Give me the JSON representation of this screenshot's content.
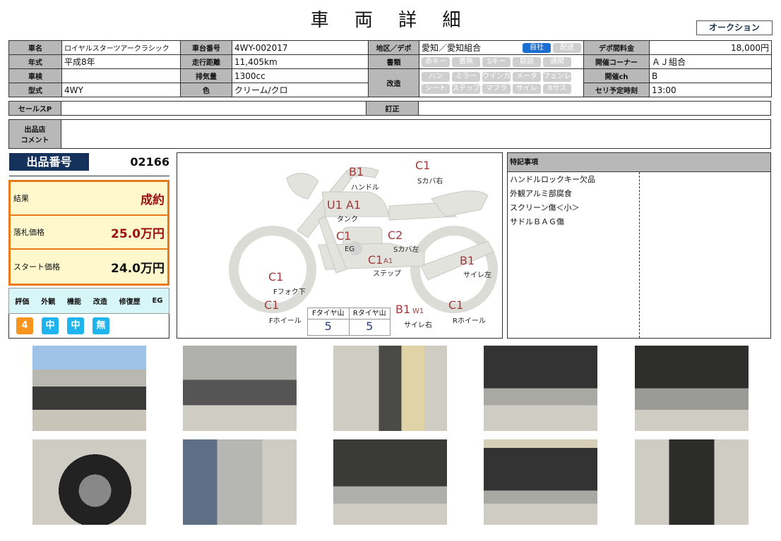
{
  "title": "車 両 詳 細",
  "auction_badge": "オークション",
  "info": {
    "rows": [
      {
        "l1": "車名",
        "v1": "ロイヤルスターツアークラシック",
        "l2": "車台番号",
        "v2": "4WY-002017",
        "l3": "地区／デポ",
        "v3": "愛知／愛知組合",
        "l4": "デポ間料金",
        "v4": "18,000円"
      },
      {
        "l1": "年式",
        "v1": "平成8年",
        "l2": "走行距離",
        "v2": "11,405km",
        "l3": "書類",
        "l4": "開催コーナー",
        "v4": "ＡＪ組合"
      },
      {
        "l1": "車検",
        "v1": "",
        "l2": "排気量",
        "v2": "1300cc",
        "l3": "改造",
        "l4": "開催ch",
        "v4": "B"
      },
      {
        "l1": "型式",
        "v1": "4WY",
        "l2": "色",
        "v2": "クリーム/クロ",
        "l4": "セリ予定時刻",
        "v4": "13:00"
      }
    ],
    "depot_chips": [
      {
        "label": "自社",
        "active": true
      },
      {
        "label": "配送",
        "active": false
      }
    ],
    "doc_chips": [
      "赤キー",
      "書無",
      "Sキー",
      "取説",
      "通関"
    ],
    "mod_chips_1": [
      "ハン",
      "ミラー",
      "ウインカ",
      "メータ",
      "フェンレス"
    ],
    "mod_chips_2": [
      "シート",
      "ステップ",
      "マフラ",
      "サイレ",
      "Rサス"
    ]
  },
  "sales_point": {
    "label": "セールスP",
    "value": ""
  },
  "correction": {
    "label": "訂正",
    "value": ""
  },
  "comment": {
    "label_1": "出品店",
    "label_2": "コメント",
    "value": ""
  },
  "lot": {
    "label": "出品番号",
    "number": "02166"
  },
  "result": {
    "result_label": "結果",
    "result_value": "成約",
    "bid_label": "落札価格",
    "bid_value": "25.0万円",
    "start_label": "スタート価格",
    "start_value": "24.0万円"
  },
  "evaluation": {
    "headers": [
      "評価",
      "外観",
      "機能",
      "改造",
      "修復歴",
      "EG"
    ],
    "values": [
      {
        "text": "4",
        "color": "#f7941d"
      },
      {
        "text": "中",
        "color": "#1fb4ee"
      },
      {
        "text": "中",
        "color": "#1fb4ee"
      },
      {
        "text": "無",
        "color": "#1fb4ee"
      }
    ]
  },
  "diagram": {
    "parts": [
      {
        "grade": "B1",
        "label": "ハンドル"
      },
      {
        "grade": "C1",
        "label": "Sカバ右"
      },
      {
        "grade": "U1 A1",
        "label": "タンク"
      },
      {
        "grade": "C1",
        "label": "EG"
      },
      {
        "grade": "C2",
        "label": "Sカバ左"
      },
      {
        "grade": "C1",
        "sub": "A1",
        "label": "ステップ"
      },
      {
        "grade": "B1",
        "label": "サイレ左"
      },
      {
        "grade": "C1",
        "label": "Fフォク下"
      },
      {
        "grade": "C1",
        "label": "Fホイール"
      },
      {
        "grade": "B1",
        "sub": "W1",
        "label": "サイレ右"
      },
      {
        "grade": "C1",
        "label": "Rホイール"
      }
    ],
    "tires": {
      "front_label": "Fタイヤ山",
      "front_value": "5",
      "rear_label": "Rタイヤ山",
      "rear_value": "5"
    }
  },
  "notes": {
    "header": "特記事項",
    "items": [
      "ハンドルロックキー欠品",
      "外観アルミ部腐食",
      "スクリーン傷＜小＞",
      "サドルＢＡＧ傷"
    ]
  },
  "photos": [
    "left-side",
    "right-side",
    "handlebar-tank",
    "muffler-rear",
    "engine",
    "front-wheel",
    "front-view",
    "engine-step",
    "saddlebag-muffler",
    "rear-view"
  ]
}
